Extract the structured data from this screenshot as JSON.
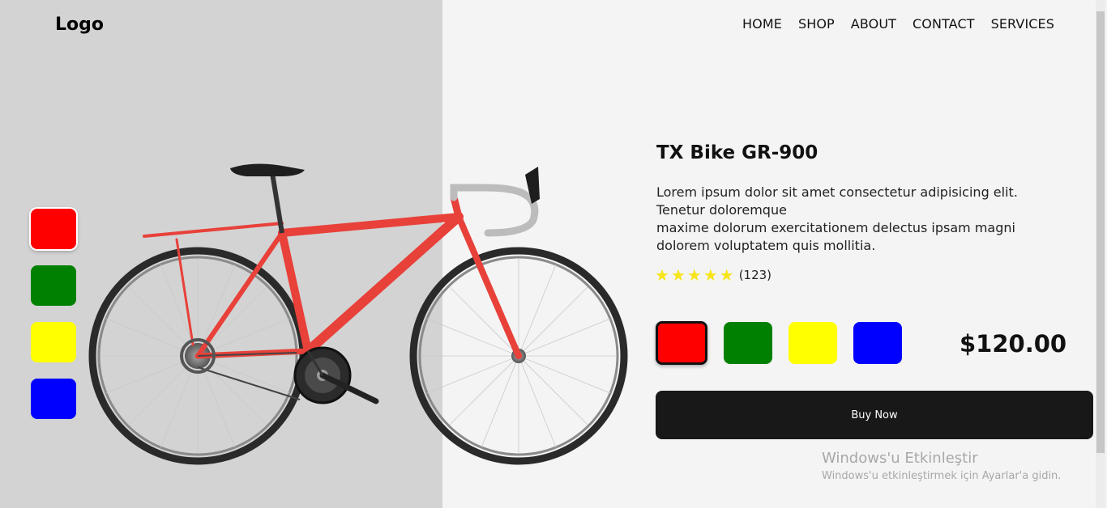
{
  "header": {
    "logo": "Logo",
    "nav": [
      "HOME",
      "SHOP",
      "ABOUT",
      "CONTACT",
      "SERVICES"
    ]
  },
  "product": {
    "title": "TX Bike GR-900",
    "description_lines": [
      "Lorem ipsum dolor sit amet consectetur adipisicing elit. Tenetur doloremque",
      "maxime dolorum exercitationem delectus ipsam magni dolorem voluptatem quis mollitia."
    ],
    "rating_stars": 5,
    "review_count": "(123)",
    "price": "$120.00",
    "buy_label": "Buy Now",
    "selected_color": "red"
  },
  "colors": [
    {
      "name": "red",
      "hex": "#ff0000"
    },
    {
      "name": "green",
      "hex": "#008000"
    },
    {
      "name": "yellow",
      "hex": "#ffff00"
    },
    {
      "name": "blue",
      "hex": "#0000ff"
    }
  ],
  "theme": {
    "left_panel_bg": "#d3d3d3",
    "page_bg": "#f4f4f4",
    "button_bg": "#181818",
    "star_color": "#f7e41b",
    "bike_frame": "#e8413a"
  },
  "watermark": {
    "title": "Windows'u Etkinleştir",
    "subtitle": "Windows'u etkinleştirmek için Ayarlar'a gidin."
  }
}
